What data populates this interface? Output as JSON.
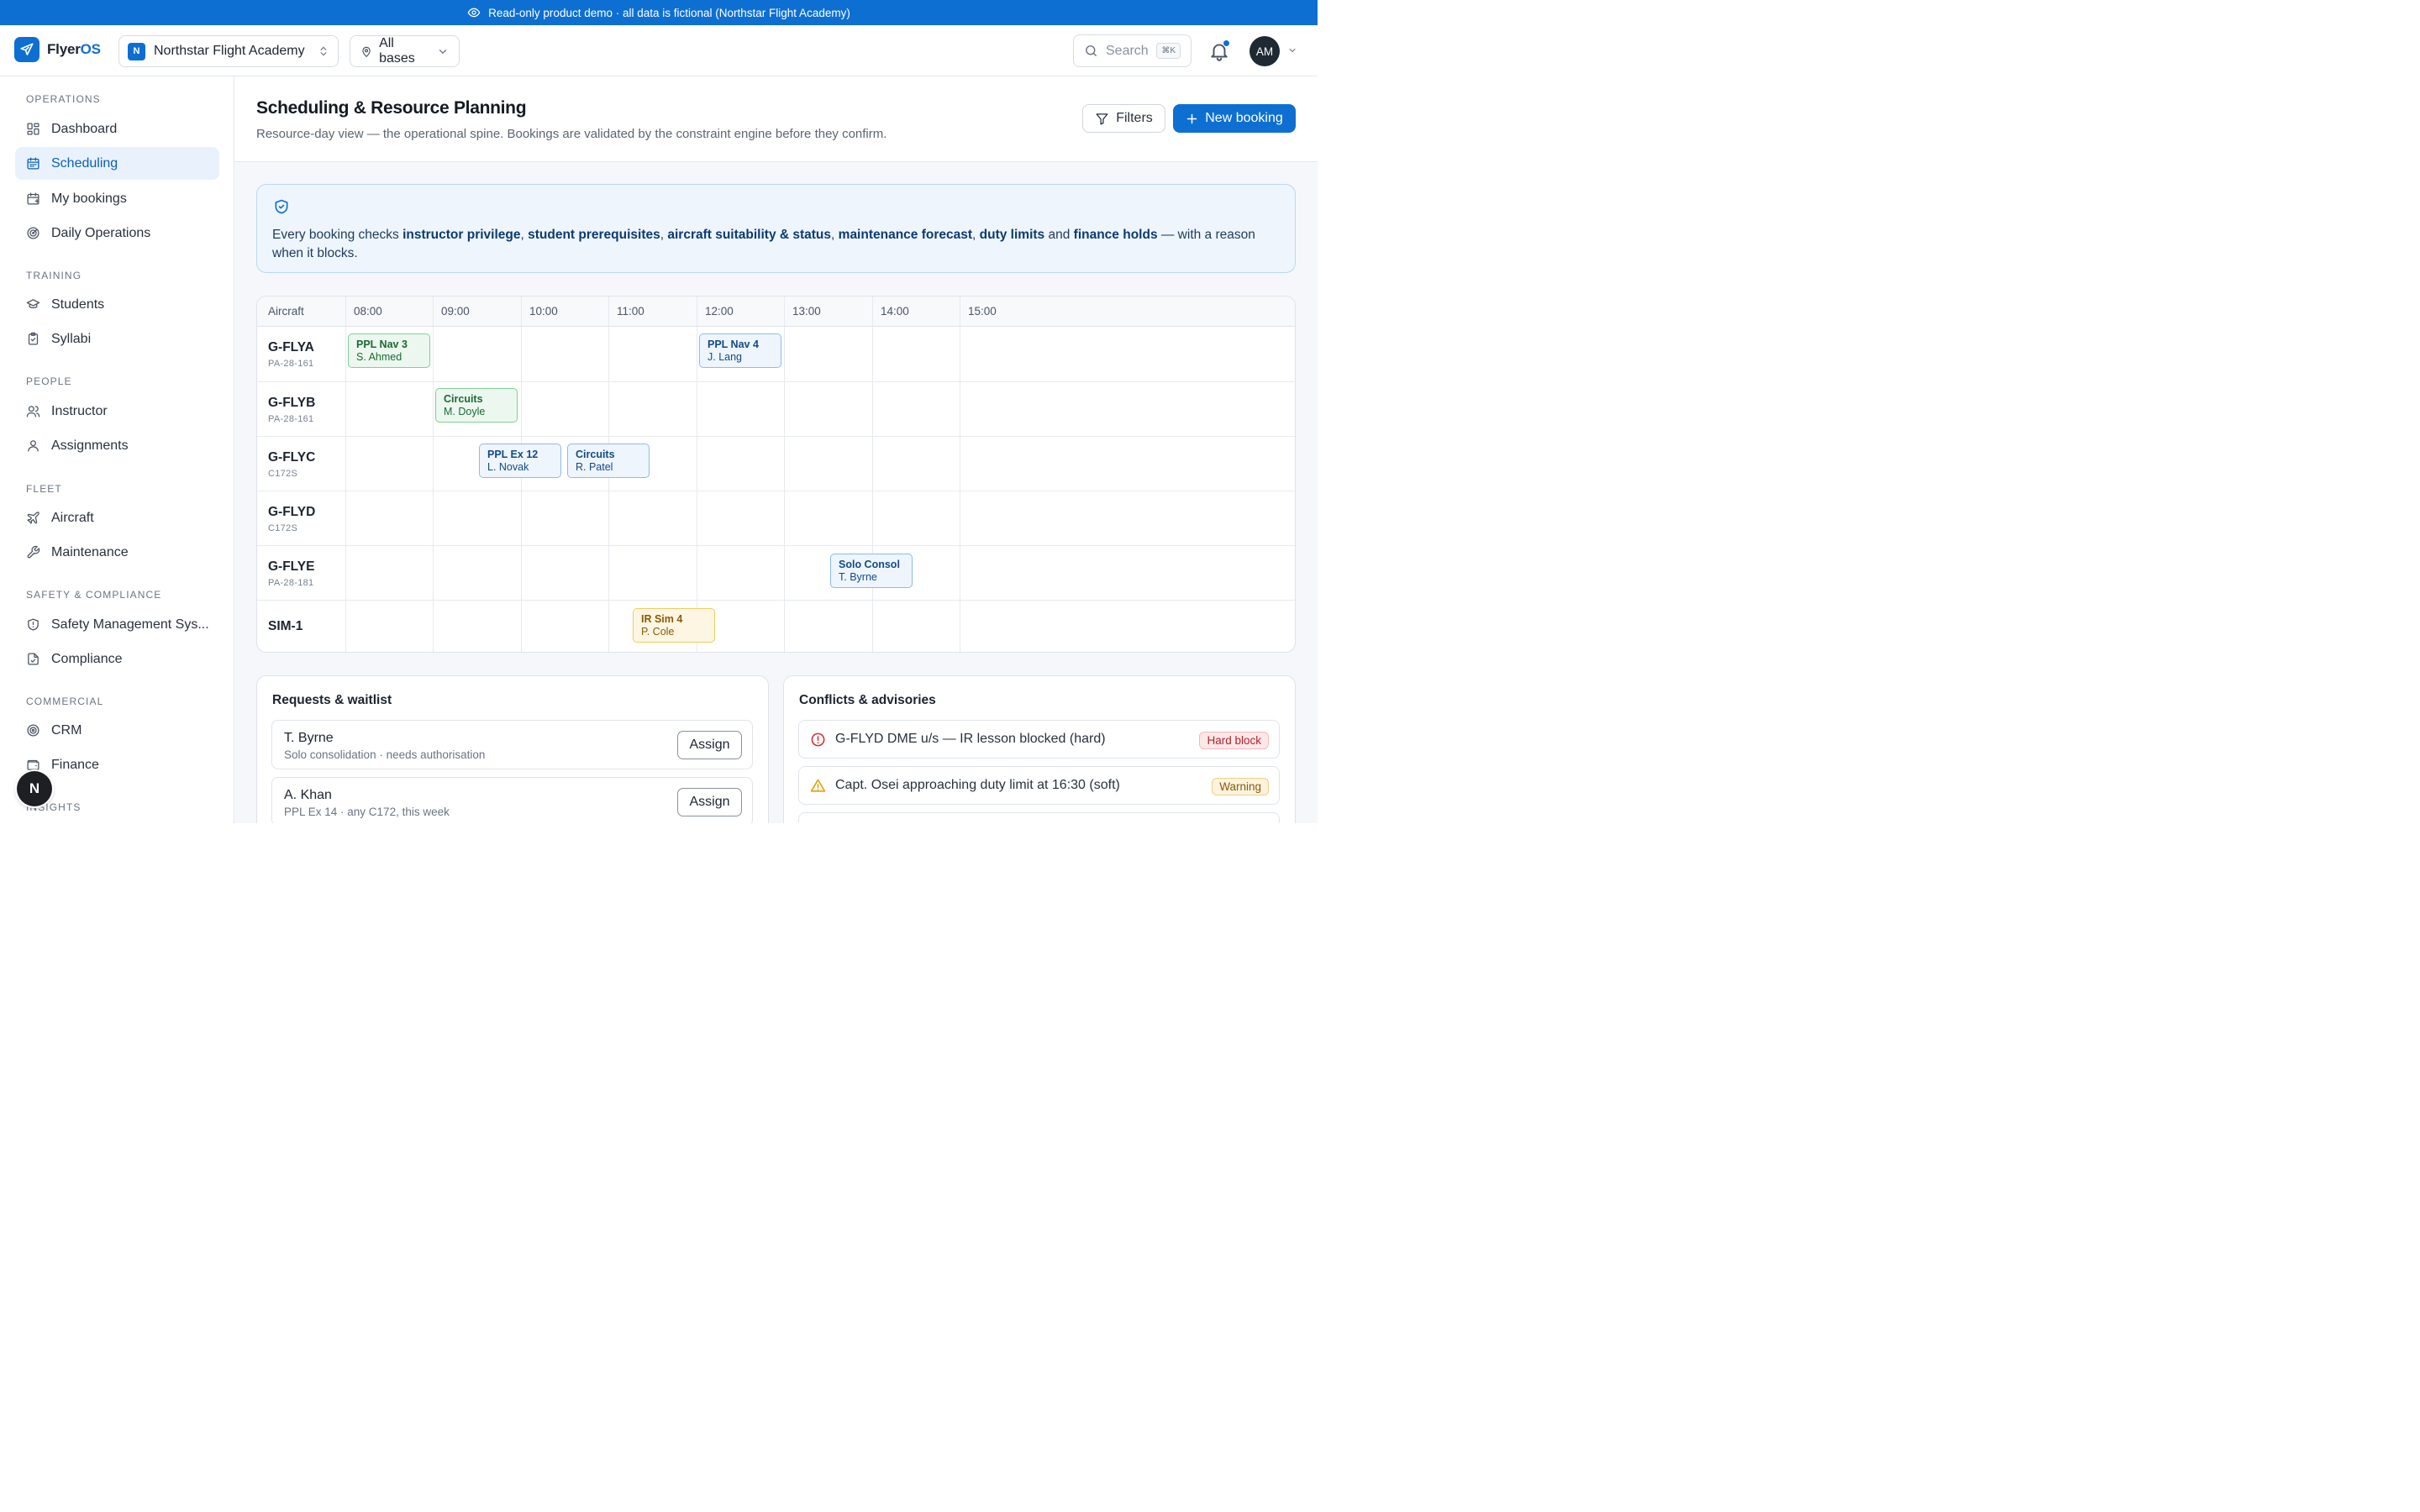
{
  "banner": {
    "text": "Read-only product demo · all data is fictional (Northstar Flight Academy)"
  },
  "header": {
    "logo_main": "Flyer",
    "logo_accent": "OS",
    "org_badge": "N",
    "org_name": "Northstar Flight Academy",
    "base_filter": "All bases",
    "search_placeholder": "Search",
    "search_shortcut": "⌘K",
    "avatar_initials": "AM"
  },
  "sidebar": {
    "sections": [
      {
        "title": "OPERATIONS",
        "items": [
          {
            "label": "Dashboard",
            "icon": "dashboard-icon"
          },
          {
            "label": "Scheduling",
            "icon": "calendar-icon",
            "active": true
          },
          {
            "label": "My bookings",
            "icon": "calendar-check-icon"
          },
          {
            "label": "Daily Operations",
            "icon": "radar-icon"
          }
        ]
      },
      {
        "title": "TRAINING",
        "items": [
          {
            "label": "Students",
            "icon": "graduation-cap-icon"
          },
          {
            "label": "Syllabi",
            "icon": "clipboard-icon"
          }
        ]
      },
      {
        "title": "PEOPLE",
        "items": [
          {
            "label": "Instructor",
            "icon": "users-icon"
          },
          {
            "label": "Assignments",
            "icon": "user-icon"
          }
        ]
      },
      {
        "title": "FLEET",
        "items": [
          {
            "label": "Aircraft",
            "icon": "plane-icon"
          },
          {
            "label": "Maintenance",
            "icon": "wrench-icon"
          }
        ]
      },
      {
        "title": "SAFETY & COMPLIANCE",
        "items": [
          {
            "label": "Safety Management Sys...",
            "icon": "shield-icon"
          },
          {
            "label": "Compliance",
            "icon": "file-check-icon"
          }
        ]
      },
      {
        "title": "COMMERCIAL",
        "items": [
          {
            "label": "CRM",
            "icon": "target-icon"
          },
          {
            "label": "Finance",
            "icon": "wallet-icon"
          }
        ]
      },
      {
        "title": "INSIGHTS",
        "items": []
      }
    ],
    "fab_label": "N"
  },
  "page": {
    "title": "Scheduling & Resource Planning",
    "subtitle": "Resource-day view — the operational spine. Bookings are validated by the constraint engine before they confirm.",
    "filters_label": "Filters",
    "new_booking_label": "New booking"
  },
  "info": {
    "prefix": "Every booking checks ",
    "b1": "instructor privilege",
    "s1": ", ",
    "b2": "student prerequisites",
    "s2": ", ",
    "b3": "aircraft suitability & status",
    "s3": ", ",
    "b4": "maintenance forecast",
    "s4": ", ",
    "b5": "duty limits",
    "s5": " and ",
    "b6": "finance holds",
    "suffix": " — with a reason when it blocks."
  },
  "schedule": {
    "resource_header": "Aircraft",
    "hours": [
      "08:00",
      "09:00",
      "10:00",
      "11:00",
      "12:00",
      "13:00",
      "14:00",
      "15:00"
    ],
    "rows": [
      {
        "reg": "G-FLYA",
        "type": "PA-28-161"
      },
      {
        "reg": "G-FLYB",
        "type": "PA-28-161"
      },
      {
        "reg": "G-FLYC",
        "type": "C172S"
      },
      {
        "reg": "G-FLYD",
        "type": "C172S"
      },
      {
        "reg": "G-FLYE",
        "type": "PA-28-181"
      },
      {
        "reg": "SIM-1",
        "type": ""
      }
    ],
    "bookings": [
      {
        "title": "PPL Nav 3",
        "person": "S. Ahmed",
        "status": "green"
      },
      {
        "title": "PPL Nav 4",
        "person": "J. Lang",
        "status": "blue"
      },
      {
        "title": "Circuits",
        "person": "M. Doyle",
        "status": "green"
      },
      {
        "title": "PPL Ex 12",
        "person": "L. Novak",
        "status": "blue"
      },
      {
        "title": "Circuits",
        "person": "R. Patel",
        "status": "blue"
      },
      {
        "title": "Solo Consol",
        "person": "T. Byrne",
        "status": "blue"
      },
      {
        "title": "IR Sim 4",
        "person": "P. Cole",
        "status": "yellow"
      }
    ]
  },
  "requests": {
    "title": "Requests & waitlist",
    "items": [
      {
        "name": "T. Byrne",
        "desc": "Solo consolidation · needs authorisation",
        "action": "Assign"
      },
      {
        "name": "A. Khan",
        "desc": "PPL Ex 14 · any C172, this week",
        "action": "Assign"
      }
    ]
  },
  "conflicts": {
    "title": "Conflicts & advisories",
    "items": [
      {
        "text": "G-FLYD DME u/s — IR lesson blocked (hard)",
        "badge": "Hard block",
        "icon": "alert-circle-icon",
        "color": "#d92d33"
      },
      {
        "text": "Capt. Osei approaching duty limit at 16:30 (soft)",
        "badge": "Warning",
        "icon": "warning-triangle-icon",
        "color": "#e0a106"
      }
    ]
  }
}
